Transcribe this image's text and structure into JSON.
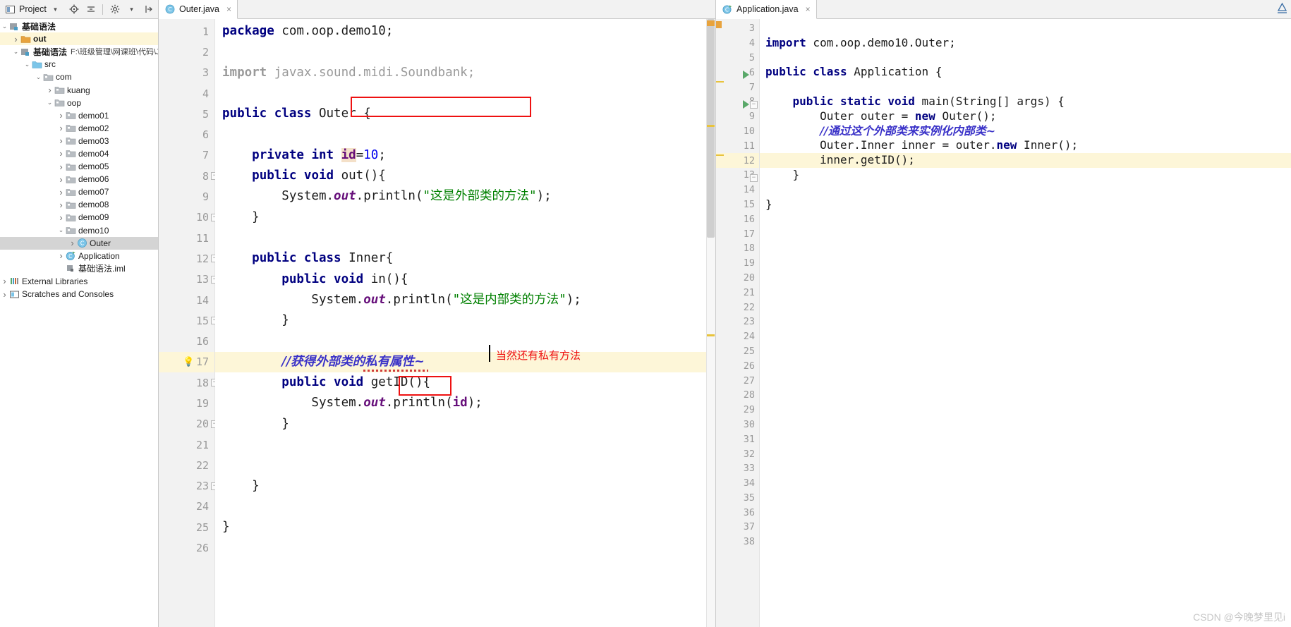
{
  "window": {
    "project_panel_title": "Project",
    "toolbar_icons": [
      "locate-icon",
      "collapse-all-icon",
      "settings-gear-icon",
      "hide-panel-icon"
    ],
    "top_right_icon": "ide-notification-icon",
    "watermark": "CSDN @今晚梦里见i"
  },
  "tree": {
    "items": [
      {
        "arrow": "down",
        "icon": "module-icon",
        "label": "基础语法",
        "bold": true,
        "indent": 0,
        "state": "normal"
      },
      {
        "arrow": "right",
        "icon": "folder-orange-icon",
        "label": "out",
        "bold": true,
        "indent": 1,
        "state": "highlight-yellow"
      },
      {
        "arrow": "down",
        "icon": "module-icon",
        "label": "基础语法",
        "bold": true,
        "indent": 1,
        "path": "F:\\班级管理\\网课班\\代码\\Ja",
        "state": "normal"
      },
      {
        "arrow": "down",
        "icon": "source-root-icon",
        "label": "src",
        "bold": false,
        "indent": 2,
        "state": "normal"
      },
      {
        "arrow": "down",
        "icon": "package-icon",
        "label": "com",
        "bold": false,
        "indent": 3,
        "state": "normal"
      },
      {
        "arrow": "right",
        "icon": "package-icon",
        "label": "kuang",
        "bold": false,
        "indent": 4,
        "state": "normal"
      },
      {
        "arrow": "down",
        "icon": "package-icon",
        "label": "oop",
        "bold": false,
        "indent": 4,
        "state": "normal"
      },
      {
        "arrow": "right",
        "icon": "package-icon",
        "label": "demo01",
        "bold": false,
        "indent": 5,
        "state": "normal"
      },
      {
        "arrow": "right",
        "icon": "package-icon",
        "label": "demo02",
        "bold": false,
        "indent": 5,
        "state": "normal"
      },
      {
        "arrow": "right",
        "icon": "package-icon",
        "label": "demo03",
        "bold": false,
        "indent": 5,
        "state": "normal"
      },
      {
        "arrow": "right",
        "icon": "package-icon",
        "label": "demo04",
        "bold": false,
        "indent": 5,
        "state": "normal"
      },
      {
        "arrow": "right",
        "icon": "package-icon",
        "label": "demo05",
        "bold": false,
        "indent": 5,
        "state": "normal"
      },
      {
        "arrow": "right",
        "icon": "package-icon",
        "label": "demo06",
        "bold": false,
        "indent": 5,
        "state": "normal"
      },
      {
        "arrow": "right",
        "icon": "package-icon",
        "label": "demo07",
        "bold": false,
        "indent": 5,
        "state": "normal"
      },
      {
        "arrow": "right",
        "icon": "package-icon",
        "label": "demo08",
        "bold": false,
        "indent": 5,
        "state": "normal"
      },
      {
        "arrow": "right",
        "icon": "package-icon",
        "label": "demo09",
        "bold": false,
        "indent": 5,
        "state": "normal"
      },
      {
        "arrow": "down",
        "icon": "package-icon",
        "label": "demo10",
        "bold": false,
        "indent": 5,
        "state": "normal"
      },
      {
        "arrow": "right",
        "icon": "java-class-icon",
        "label": "Outer",
        "bold": false,
        "indent": 6,
        "state": "selected-gray"
      },
      {
        "arrow": "right",
        "icon": "java-runnable-class-icon",
        "label": "Application",
        "bold": false,
        "indent": 5,
        "state": "normal"
      },
      {
        "arrow": "none",
        "icon": "iml-file-icon",
        "label": "基础语法.iml",
        "bold": false,
        "indent": 5,
        "state": "normal"
      },
      {
        "arrow": "right",
        "icon": "external-libraries-icon",
        "label": "External Libraries",
        "bold": false,
        "indent": 0,
        "state": "normal"
      },
      {
        "arrow": "right",
        "icon": "scratches-icon",
        "label": "Scratches and Consoles",
        "bold": false,
        "indent": 0,
        "state": "normal"
      }
    ]
  },
  "editors": {
    "left": {
      "tab_label": "Outer.java",
      "tab_icon": "java-class-icon",
      "tab_close": "×",
      "first_line_number": 1,
      "lines": [
        {
          "n": 1,
          "tokens": [
            {
              "t": "package",
              "c": "kw"
            },
            {
              "t": " com.oop.demo10;",
              "c": "plain"
            }
          ]
        },
        {
          "n": 2,
          "tokens": []
        },
        {
          "n": 3,
          "tokens": [
            {
              "t": "import",
              "c": "kw grey"
            },
            {
              "t": " javax.sound.midi.Soundbank;",
              "c": "grey"
            }
          ]
        },
        {
          "n": 4,
          "tokens": []
        },
        {
          "n": 5,
          "tokens": [
            {
              "t": "public class",
              "c": "kw"
            },
            {
              "t": " Outer {",
              "c": "plain"
            }
          ]
        },
        {
          "n": 6,
          "tokens": []
        },
        {
          "n": 7,
          "tokens": [
            {
              "t": "    ",
              "c": "plain"
            },
            {
              "t": "private int",
              "c": "kw"
            },
            {
              "t": " ",
              "c": "plain"
            },
            {
              "t": "id",
              "c": "idfield"
            },
            {
              "t": "=",
              "c": "plain"
            },
            {
              "t": "10",
              "c": "num"
            },
            {
              "t": ";",
              "c": "plain"
            }
          ],
          "boxed": true
        },
        {
          "n": 8,
          "tokens": [
            {
              "t": "    ",
              "c": "plain"
            },
            {
              "t": "public void",
              "c": "kw"
            },
            {
              "t": " out(){",
              "c": "plain"
            }
          ],
          "fold": true
        },
        {
          "n": 9,
          "tokens": [
            {
              "t": "        System.",
              "c": "plain"
            },
            {
              "t": "out",
              "c": "stat"
            },
            {
              "t": ".println(",
              "c": "plain"
            },
            {
              "t": "\"这是外部类的方法\"",
              "c": "str"
            },
            {
              "t": ");",
              "c": "plain"
            }
          ]
        },
        {
          "n": 10,
          "tokens": [
            {
              "t": "    }",
              "c": "plain"
            }
          ],
          "fold": true
        },
        {
          "n": 11,
          "tokens": []
        },
        {
          "n": 12,
          "tokens": [
            {
              "t": "    ",
              "c": "plain"
            },
            {
              "t": "public class",
              "c": "kw"
            },
            {
              "t": " Inner{",
              "c": "plain"
            }
          ],
          "fold": true
        },
        {
          "n": 13,
          "tokens": [
            {
              "t": "        ",
              "c": "plain"
            },
            {
              "t": "public void",
              "c": "kw"
            },
            {
              "t": " in(){",
              "c": "plain"
            }
          ],
          "fold": true
        },
        {
          "n": 14,
          "tokens": [
            {
              "t": "            System.",
              "c": "plain"
            },
            {
              "t": "out",
              "c": "stat"
            },
            {
              "t": ".println(",
              "c": "plain"
            },
            {
              "t": "\"这是内部类的方法\"",
              "c": "str"
            },
            {
              "t": ");",
              "c": "plain"
            }
          ]
        },
        {
          "n": 15,
          "tokens": [
            {
              "t": "        }",
              "c": "plain"
            }
          ],
          "fold": true
        },
        {
          "n": 16,
          "tokens": []
        },
        {
          "n": 17,
          "tokens": [
            {
              "t": "        ",
              "c": "plain"
            },
            {
              "t": "//获得外部类的私有属性~",
              "c": "zhcmt"
            }
          ],
          "highlight": true,
          "bulb": true
        },
        {
          "n": 18,
          "tokens": [
            {
              "t": "        ",
              "c": "plain"
            },
            {
              "t": "public void",
              "c": "kw"
            },
            {
              "t": " getID(){",
              "c": "plain"
            }
          ],
          "fold": true
        },
        {
          "n": 19,
          "tokens": [
            {
              "t": "            System.",
              "c": "plain"
            },
            {
              "t": "out",
              "c": "stat"
            },
            {
              "t": ".println(",
              "c": "plain"
            },
            {
              "t": "id",
              "c": "fld"
            },
            {
              "t": ");",
              "c": "plain"
            }
          ]
        },
        {
          "n": 20,
          "tokens": [
            {
              "t": "        }",
              "c": "plain"
            }
          ],
          "fold": true
        },
        {
          "n": 21,
          "tokens": []
        },
        {
          "n": 22,
          "tokens": []
        },
        {
          "n": 23,
          "tokens": [
            {
              "t": "    }",
              "c": "plain"
            }
          ],
          "fold": true
        },
        {
          "n": 24,
          "tokens": []
        },
        {
          "n": 25,
          "tokens": [
            {
              "t": "}",
              "c": "plain"
            }
          ]
        },
        {
          "n": 26,
          "tokens": []
        }
      ]
    },
    "right": {
      "tab_label": "Application.java",
      "tab_icon": "java-runnable-class-icon",
      "tab_close": "×",
      "lines": [
        {
          "n": 3,
          "tokens": []
        },
        {
          "n": 4,
          "tokens": [
            {
              "t": "import",
              "c": "kw"
            },
            {
              "t": " com.oop.demo10.Outer;",
              "c": "plain"
            }
          ]
        },
        {
          "n": 5,
          "tokens": []
        },
        {
          "n": 6,
          "tokens": [
            {
              "t": "public class",
              "c": "kw"
            },
            {
              "t": " Application {",
              "c": "plain"
            }
          ],
          "run": true
        },
        {
          "n": 7,
          "tokens": []
        },
        {
          "n": 8,
          "tokens": [
            {
              "t": "    ",
              "c": "plain"
            },
            {
              "t": "public static void",
              "c": "kw"
            },
            {
              "t": " main(String[] args) {",
              "c": "plain"
            }
          ],
          "run": true,
          "fold": true
        },
        {
          "n": 9,
          "tokens": [
            {
              "t": "        Outer outer = ",
              "c": "plain"
            },
            {
              "t": "new",
              "c": "kw"
            },
            {
              "t": " Outer();",
              "c": "plain"
            }
          ]
        },
        {
          "n": 10,
          "tokens": [
            {
              "t": "        ",
              "c": "plain"
            },
            {
              "t": "//通过这个外部类来实例化内部类~",
              "c": "zhcmt"
            }
          ]
        },
        {
          "n": 11,
          "tokens": [
            {
              "t": "        Outer.Inner inner = outer.",
              "c": "plain"
            },
            {
              "t": "new",
              "c": "kw"
            },
            {
              "t": " Inner();",
              "c": "plain"
            }
          ]
        },
        {
          "n": 12,
          "tokens": [
            {
              "t": "        inner.getID();",
              "c": "plain"
            }
          ],
          "highlight": true
        },
        {
          "n": 13,
          "tokens": [
            {
              "t": "    }",
              "c": "plain"
            }
          ],
          "fold": true
        },
        {
          "n": 14,
          "tokens": []
        },
        {
          "n": 15,
          "tokens": [
            {
              "t": "}",
              "c": "plain"
            }
          ]
        },
        {
          "n": 16,
          "tokens": []
        },
        {
          "n": 17,
          "tokens": []
        },
        {
          "n": 18,
          "tokens": []
        },
        {
          "n": 19,
          "tokens": []
        },
        {
          "n": 20,
          "tokens": []
        },
        {
          "n": 21,
          "tokens": []
        },
        {
          "n": 22,
          "tokens": []
        },
        {
          "n": 23,
          "tokens": []
        },
        {
          "n": 24,
          "tokens": []
        },
        {
          "n": 25,
          "tokens": []
        },
        {
          "n": 26,
          "tokens": []
        },
        {
          "n": 27,
          "tokens": []
        },
        {
          "n": 28,
          "tokens": []
        },
        {
          "n": 29,
          "tokens": []
        },
        {
          "n": 30,
          "tokens": []
        },
        {
          "n": 31,
          "tokens": []
        },
        {
          "n": 32,
          "tokens": []
        },
        {
          "n": 33,
          "tokens": []
        },
        {
          "n": 34,
          "tokens": []
        },
        {
          "n": 35,
          "tokens": []
        },
        {
          "n": 36,
          "tokens": []
        },
        {
          "n": 37,
          "tokens": []
        },
        {
          "n": 38,
          "tokens": []
        }
      ]
    }
  },
  "annotations": {
    "box_private_id_label": "private int id=10;",
    "box_getid_label": "getID",
    "red_note": "当然还有私有方法",
    "accent_red": "#ee1111",
    "accent_comment_blue": "#3a32c8"
  }
}
